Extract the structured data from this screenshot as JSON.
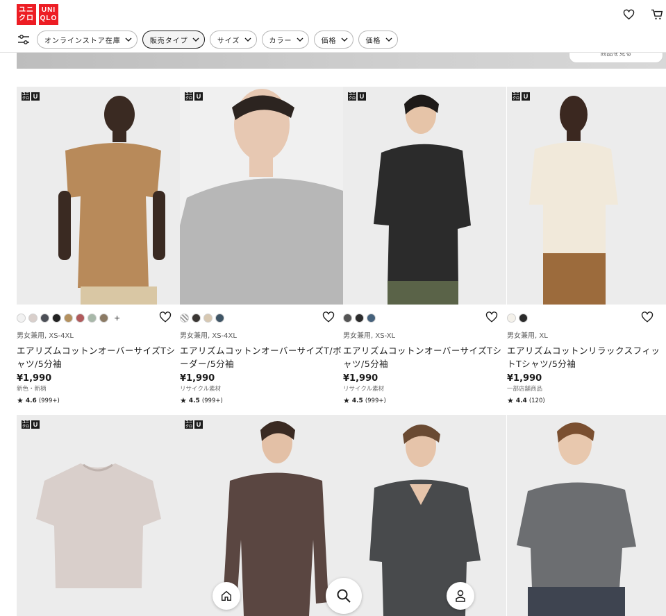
{
  "header": {
    "logo_top": "ユニ",
    "logo_bottom": "クロ",
    "logo_en_top": "UNI",
    "logo_en_bottom": "QLO"
  },
  "filters": [
    {
      "label": "オンラインストア在庫",
      "active": false
    },
    {
      "label": "販売タイプ",
      "active": true
    },
    {
      "label": "サイズ",
      "active": false
    },
    {
      "label": "カラー",
      "active": false
    },
    {
      "label": "価格",
      "active": false
    },
    {
      "label": "価格",
      "active": false
    }
  ],
  "banner": {
    "button_label": "商品を見る"
  },
  "badges": {
    "ja_top": "ユニ",
    "ja_bottom": "クロ",
    "u": "U"
  },
  "products": [
    {
      "meta": "男女兼用, XS-4XL",
      "name": "エアリズムコットンオーバーサイズTシャツ/5分袖",
      "price": "¥1,990",
      "note": "新色・新柄",
      "rating": "4.6",
      "reviews": "(999+)",
      "swatches": [
        "#f2f2f2",
        "#d9cfcb",
        "#4c4f57",
        "#222222",
        "#b4915f",
        "#b15a5c",
        "#a8b8a9",
        "#8b7a64"
      ],
      "more": "+"
    },
    {
      "meta": "男女兼用, XS-4XL",
      "name": "エアリズムコットンオーバーサイズT/ボーダー/5分袖",
      "price": "¥1,990",
      "note": "リサイクル素材",
      "rating": "4.5",
      "reviews": "(999+)",
      "swatches": [
        "#9c9c9c",
        "#3a3633",
        "#d7c8b2",
        "#3f5566"
      ],
      "more": ""
    },
    {
      "meta": "男女兼用, XS-XL",
      "name": "エアリズムコットンオーバーサイズTシャツ/5分袖",
      "price": "¥1,990",
      "note": "リサイクル素材",
      "rating": "4.5",
      "reviews": "(999+)",
      "swatches": [
        "#555555",
        "#2c2c2c",
        "#46627c"
      ],
      "more": ""
    },
    {
      "meta": "男女兼用, XL",
      "name": "エアリズムコットンリラックスフィットTシャツ/5分袖",
      "price": "¥1,990",
      "note": "一部店舗商品",
      "rating": "4.4",
      "reviews": "(120)",
      "swatches": [
        "#f4f1ea",
        "#2b2b2b"
      ],
      "more": ""
    }
  ],
  "rating_star": "★",
  "colors": {
    "brand": "#ed1d24",
    "tan_tshirt": "#b88a5a",
    "grey_tshirt": "#b7b7b7",
    "black_tshirt": "#2b2b2b",
    "cream_tshirt": "#f1e9da",
    "lilac_tshirt": "#d9cfcb",
    "brown_longsleeve": "#5a4641",
    "charcoal_vneck": "#484a4c",
    "slate_tshirt": "#6c6e71"
  }
}
